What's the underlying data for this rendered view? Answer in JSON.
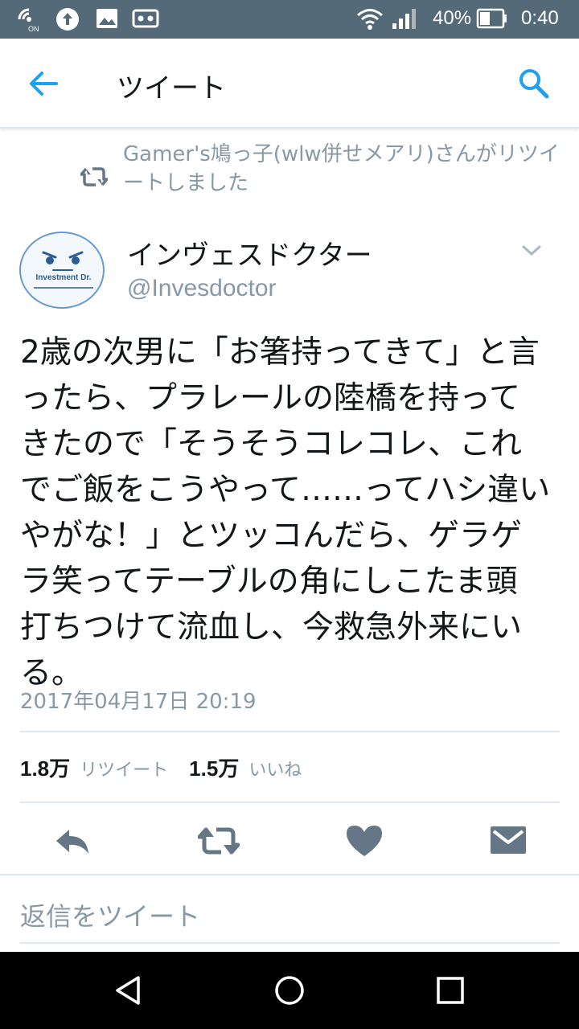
{
  "status_bar": {
    "battery": "40%",
    "time": "0:40",
    "icons": [
      "nfc-on-icon",
      "upload-icon",
      "image-icon",
      "voicemail-icon",
      "wifi-icon",
      "signal-icon",
      "battery-icon"
    ]
  },
  "app_bar": {
    "title": "ツイート",
    "back_icon": "arrow-left-icon",
    "search_icon": "search-icon",
    "accent_color": "#1da1f2"
  },
  "retweet_context": {
    "icon": "retweet-icon",
    "text": "Gamer's鳩っ子(wlw併せメアリ)さんがリツイートしました"
  },
  "tweet": {
    "avatar_text": "Investment Dr.",
    "author_name": "インヴェスドクター",
    "author_handle": "@Invesdoctor",
    "text": "2歳の次男に「お箸持ってきて」と言\nったら、プラレールの陸橋を持って\nきたので「そうそうコレコレ、これ\nでご飯をこうやって……ってハシ違い\nやがな！」とツッコんだら、ゲラゲ\nラ笑ってテーブルの角にしこたま頭\n打ちつけて流血し、今救急外来にい\nる。",
    "timestamp": "2017年04月17日 20:19",
    "retweet_count": "1.8万",
    "retweet_label": "リツイート",
    "like_count": "1.5万",
    "like_label": "いいね"
  },
  "actions": [
    "reply-icon",
    "retweet-icon",
    "heart-icon",
    "message-icon"
  ],
  "reply_placeholder": "返信をツイート",
  "nav_bar": [
    "back-triangle-icon",
    "home-circle-icon",
    "recents-square-icon"
  ]
}
